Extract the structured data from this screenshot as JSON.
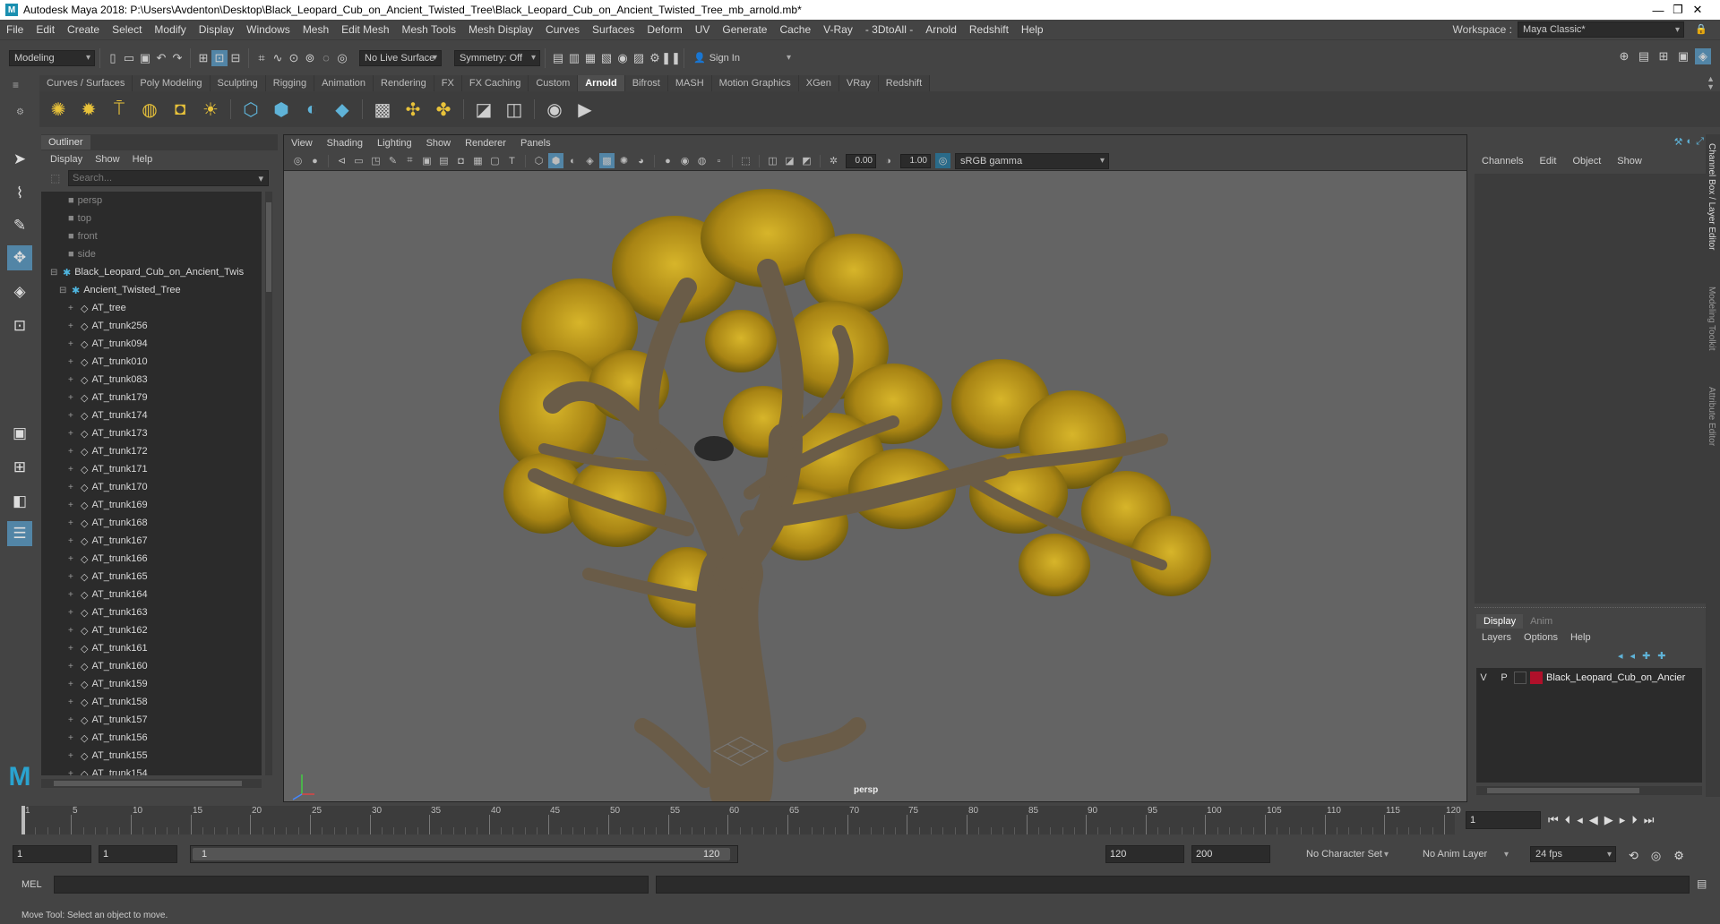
{
  "titlebar": {
    "text": "Autodesk Maya 2018: P:\\Users\\Avdenton\\Desktop\\Black_Leopard_Cub_on_Ancient_Twisted_Tree\\Black_Leopard_Cub_on_Ancient_Twisted_Tree_mb_arnold.mb*"
  },
  "menubar": {
    "items": [
      "File",
      "Edit",
      "Create",
      "Select",
      "Modify",
      "Display",
      "Windows",
      "Mesh",
      "Edit Mesh",
      "Mesh Tools",
      "Mesh Display",
      "Curves",
      "Surfaces",
      "Deform",
      "UV",
      "Generate",
      "Cache",
      "V-Ray",
      "- 3DtoAll -",
      "Arnold",
      "Redshift",
      "Help"
    ],
    "workspace_label": "Workspace :",
    "workspace_value": "Maya Classic*"
  },
  "statusline": {
    "mode": "Modeling",
    "live_surface": "No Live Surface",
    "symmetry": "Symmetry: Off",
    "sign_in": "Sign In"
  },
  "shelf": {
    "tabs": [
      "Curves / Surfaces",
      "Poly Modeling",
      "Sculpting",
      "Rigging",
      "Animation",
      "Rendering",
      "FX",
      "FX Caching",
      "Custom",
      "Arnold",
      "Bifrost",
      "MASH",
      "Motion Graphics",
      "XGen",
      "VRay",
      "Redshift"
    ],
    "active_tab": "Arnold"
  },
  "outliner": {
    "tab": "Outliner",
    "menu": [
      "Display",
      "Show",
      "Help"
    ],
    "search_placeholder": "Search...",
    "cameras": [
      "persp",
      "top",
      "front",
      "side"
    ],
    "root": "Black_Leopard_Cub_on_Ancient_Twis",
    "group": "Ancient_Twisted_Tree",
    "items": [
      "AT_tree",
      "AT_trunk256",
      "AT_trunk094",
      "AT_trunk010",
      "AT_trunk083",
      "AT_trunk179",
      "AT_trunk174",
      "AT_trunk173",
      "AT_trunk172",
      "AT_trunk171",
      "AT_trunk170",
      "AT_trunk169",
      "AT_trunk168",
      "AT_trunk167",
      "AT_trunk166",
      "AT_trunk165",
      "AT_trunk164",
      "AT_trunk163",
      "AT_trunk162",
      "AT_trunk161",
      "AT_trunk160",
      "AT_trunk159",
      "AT_trunk158",
      "AT_trunk157",
      "AT_trunk156",
      "AT_trunk155",
      "AT_trunk154"
    ]
  },
  "viewport": {
    "menu": [
      "View",
      "Shading",
      "Lighting",
      "Show",
      "Renderer",
      "Panels"
    ],
    "exposure": "0.00",
    "gamma": "1.00",
    "color_space": "sRGB gamma",
    "camera_label": "persp"
  },
  "channelbox": {
    "menu": [
      "Channels",
      "Edit",
      "Object",
      "Show"
    ],
    "layer_tabs": [
      "Display",
      "Anim"
    ],
    "layer_menu": [
      "Layers",
      "Options",
      "Help"
    ],
    "layer": {
      "v": "V",
      "p": "P",
      "name": "Black_Leopard_Cub_on_Ancier",
      "color": "#b0102a"
    }
  },
  "sidetabs": [
    "Channel Box / Layer Editor",
    "Modeling Toolkit",
    "Attribute Editor"
  ],
  "timeline": {
    "ticks": [
      "1",
      "5",
      "10",
      "15",
      "20",
      "25",
      "30",
      "35",
      "40",
      "45",
      "50",
      "55",
      "60",
      "65",
      "70",
      "75",
      "80",
      "85",
      "90",
      "95",
      "100",
      "105",
      "110",
      "115",
      "120"
    ],
    "current_frame": "1"
  },
  "range": {
    "start": "1",
    "playback_start": "1",
    "slider_start": "1",
    "slider_end": "120",
    "playback_end": "120",
    "end": "200",
    "character_set": "No Character Set",
    "anim_layer": "No Anim Layer",
    "fps": "24 fps"
  },
  "cmdline": {
    "label": "MEL"
  },
  "helpline": {
    "text": "Move Tool: Select an object to move."
  },
  "colors": {
    "accent": "#5285a6",
    "leaves": "#c8a21a",
    "bark": "#6a5c48"
  }
}
